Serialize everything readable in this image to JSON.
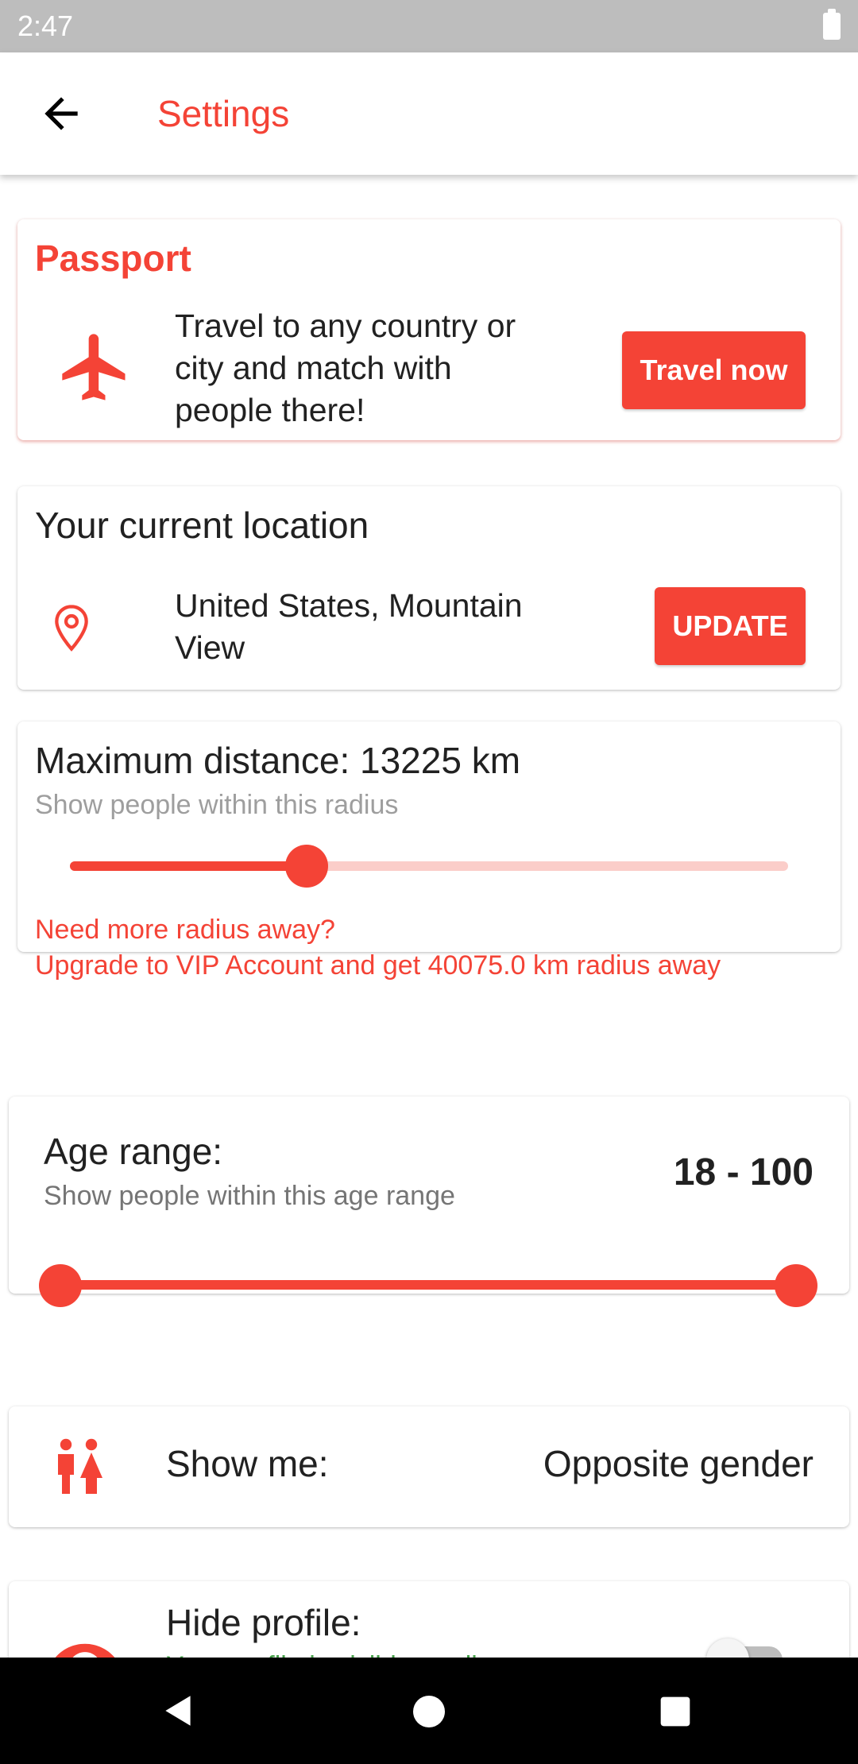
{
  "status_bar": {
    "time": "2:47",
    "battery_icon": "battery-full-icon"
  },
  "app_bar": {
    "title": "Settings",
    "back_icon": "arrow-back-icon"
  },
  "passport": {
    "title": "Passport",
    "icon": "airplane-icon",
    "description": [
      "Travel to any country or",
      "city and match with",
      "people there!"
    ],
    "button_label": "Travel now"
  },
  "location": {
    "title": "Your current location",
    "icon": "location-pin-icon",
    "value": [
      "United States, Mountain",
      "View"
    ],
    "button_label": "UPDATE"
  },
  "distance": {
    "title": "Maximum distance: 13225 km",
    "subtitle": "Show people within this radius",
    "slider_value_fraction": 0.33,
    "upsell_line1": "Need more radius away?",
    "upsell_line2": "Upgrade to VIP Account and get 40075.0 km radius away"
  },
  "age_range": {
    "title": "Age range:",
    "subtitle": "Show people within this age range",
    "value": "18 - 100",
    "min": 18,
    "max": 100
  },
  "show_me": {
    "icon": "couple-icon",
    "label": "Show me:",
    "value": "Opposite gender"
  },
  "hide_profile": {
    "icon": "eye-icon",
    "label": "Hide profile:",
    "subtitle": "Your profile is visible on discover",
    "toggle_on": false
  },
  "colors": {
    "accent": "#f44336",
    "accent_light": "#fbcdc9",
    "success": "#43a047"
  },
  "nav_bar": {
    "back_icon": "nav-back-icon",
    "home_icon": "nav-home-icon",
    "recents_icon": "nav-recents-icon"
  }
}
